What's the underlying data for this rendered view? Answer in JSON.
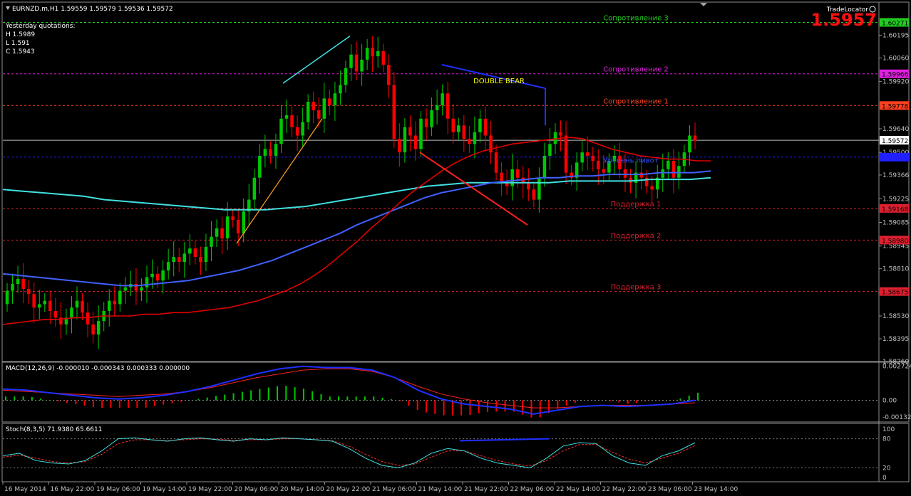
{
  "header": {
    "symbol_line": "EURNZD.m,H1  1.59559 1.59579 1.59536 1.59572",
    "yesterday_title": "Yesterday quotations:",
    "yesterday_h": "H 1.5989",
    "yesterday_l": "L 1.591",
    "yesterday_c": "C 1.5943",
    "brand": "TradeLocator",
    "big_price": "1.5957",
    "pattern_label": "DOUBLE BEAR",
    "pivot_label": "Уровень пивот"
  },
  "colors": {
    "bull": "#00c800",
    "bear": "#ff0000",
    "ma_fast": "#e00000",
    "ma_mid": "#4060ff",
    "ma_slow": "#40e0e0",
    "grid_text": "#c0c0c0",
    "resistance3": "#22cc22",
    "resistance2": "#e020e0",
    "resistance1": "#ff4020",
    "support": "#e02030"
  },
  "levels": [
    {
      "name": "Сопротивление 3",
      "price": 1.60271,
      "badge": "1.60271",
      "color": "#22cc22",
      "badge_bg": "#22cc22",
      "badge_fg": "#000000"
    },
    {
      "name": "Сопротивление 2",
      "price": 1.59966,
      "badge": "1.59966",
      "color": "#e020e0",
      "badge_bg": "#e020e0",
      "badge_fg": "#000000"
    },
    {
      "name": "Сопротивление 1",
      "price": 1.59778,
      "badge": "1.59778",
      "color": "#ff4020",
      "badge_bg": "#ff4020",
      "badge_fg": "#000000"
    },
    {
      "name": "",
      "price": 1.59572,
      "badge": "1.59572",
      "color": "#c0c0c0",
      "badge_bg": "#ffffff",
      "badge_fg": "#000000"
    },
    {
      "name": "",
      "price": 1.59472,
      "badge": "1.59472",
      "color": "#2020ff",
      "badge_bg": "#2020ff",
      "badge_fg": "#2020ff"
    },
    {
      "name": "Поддержка 1",
      "price": 1.59168,
      "badge": "1.59168",
      "color": "#e02030",
      "badge_bg": "#e02030",
      "badge_fg": "#000000"
    },
    {
      "name": "Поддержка 2",
      "price": 1.5898,
      "badge": "1.58980",
      "color": "#e02030",
      "badge_bg": "#e02030",
      "badge_fg": "#000000"
    },
    {
      "name": "Поддержка 3",
      "price": 1.58675,
      "badge": "1.58675",
      "color": "#e02030",
      "badge_bg": "#e02030",
      "badge_fg": "#000000"
    }
  ],
  "chart_data": [
    {
      "type": "candlestick",
      "title": "EURNZD.m,H1",
      "ylim": [
        1.5826,
        1.6037
      ],
      "y_ticks": [
        "1.60195",
        "1.60060",
        "1.59920",
        "1.59640",
        "1.59500",
        "1.59366",
        "1.59225",
        "1.59085",
        "1.58945",
        "1.58810",
        "1.58670",
        "1.58530",
        "1.58395",
        "1.58260"
      ],
      "x_ticks": [
        "16 May 2014",
        "16 May 22:00",
        "19 May 06:00",
        "19 May 14:00",
        "19 May 22:00",
        "20 May 06:00",
        "20 May 14:00",
        "20 May 22:00",
        "21 May 06:00",
        "21 May 14:00",
        "21 May 22:00",
        "22 May 06:00",
        "22 May 14:00",
        "22 May 22:00",
        "23 May 06:00",
        "23 May 14:00"
      ],
      "candles_close": [
        1.5868,
        1.5872,
        1.5875,
        1.5869,
        1.5866,
        1.5858,
        1.586,
        1.5862,
        1.5856,
        1.5852,
        1.5848,
        1.5852,
        1.5858,
        1.5862,
        1.5855,
        1.5848,
        1.5842,
        1.585,
        1.5856,
        1.5862,
        1.586,
        1.5868,
        1.587,
        1.5872,
        1.5868,
        1.587,
        1.5876,
        1.5878,
        1.5874,
        1.588,
        1.5885,
        1.5888,
        1.5885,
        1.589,
        1.5893,
        1.5888,
        1.5885,
        1.5894,
        1.59,
        1.5905,
        1.5899,
        1.5912,
        1.591,
        1.5902,
        1.5915,
        1.5922,
        1.5935,
        1.5948,
        1.5952,
        1.5948,
        1.5955,
        1.597,
        1.5972,
        1.5965,
        1.596,
        1.5968,
        1.598,
        1.5975,
        1.597,
        1.5982,
        1.5978,
        1.5985,
        1.599,
        1.6,
        1.6008,
        1.5998,
        1.6005,
        1.6012,
        1.6007,
        1.601,
        1.6002,
        1.599,
        1.5958,
        1.595,
        1.5965,
        1.596,
        1.5952,
        1.597,
        1.5965,
        1.5975,
        1.5978,
        1.5985,
        1.597,
        1.5962,
        1.5966,
        1.5958,
        1.5955,
        1.5962,
        1.597,
        1.596,
        1.595,
        1.5938,
        1.5932,
        1.593,
        1.594,
        1.5935,
        1.5932,
        1.5928,
        1.5922,
        1.5935,
        1.5948,
        1.5955,
        1.5962,
        1.596,
        1.5938,
        1.5935,
        1.5944,
        1.595,
        1.5948,
        1.5945,
        1.594,
        1.5938,
        1.5945,
        1.5948,
        1.594,
        1.5935,
        1.5932,
        1.5938,
        1.5935,
        1.593,
        1.5928,
        1.5935,
        1.594,
        1.5945,
        1.5935,
        1.5942,
        1.595,
        1.596,
        1.5957
      ],
      "candles_open": [
        1.586,
        1.5868,
        1.5872,
        1.5875,
        1.5869,
        1.5866,
        1.5858,
        1.586,
        1.5862,
        1.5856,
        1.5852,
        1.5848,
        1.5852,
        1.5858,
        1.5862,
        1.5855,
        1.5848,
        1.5842,
        1.585,
        1.5856,
        1.5862,
        1.586,
        1.5868,
        1.587,
        1.5872,
        1.5868,
        1.587,
        1.5876,
        1.5878,
        1.5874,
        1.588,
        1.5885,
        1.5888,
        1.5885,
        1.589,
        1.5893,
        1.5888,
        1.5885,
        1.5894,
        1.59,
        1.5905,
        1.5899,
        1.5912,
        1.591,
        1.5902,
        1.5915,
        1.5922,
        1.5935,
        1.5948,
        1.5952,
        1.5948,
        1.5955,
        1.597,
        1.5972,
        1.5965,
        1.596,
        1.5968,
        1.598,
        1.5975,
        1.597,
        1.5982,
        1.5978,
        1.5985,
        1.599,
        1.6,
        1.6008,
        1.5998,
        1.6005,
        1.6012,
        1.6007,
        1.601,
        1.6002,
        1.599,
        1.5958,
        1.595,
        1.5965,
        1.596,
        1.5952,
        1.597,
        1.5965,
        1.5975,
        1.5978,
        1.5985,
        1.597,
        1.5962,
        1.5966,
        1.5958,
        1.5955,
        1.5962,
        1.597,
        1.596,
        1.595,
        1.5938,
        1.5932,
        1.593,
        1.594,
        1.5935,
        1.5932,
        1.5928,
        1.5922,
        1.5935,
        1.5948,
        1.5955,
        1.5962,
        1.596,
        1.5938,
        1.5935,
        1.5944,
        1.595,
        1.5948,
        1.5945,
        1.594,
        1.5938,
        1.5945,
        1.5948,
        1.594,
        1.5935,
        1.5932,
        1.5938,
        1.5935,
        1.593,
        1.5928,
        1.5935,
        1.594,
        1.5945,
        1.5935,
        1.5942,
        1.595,
        1.596
      ],
      "ma_fast": [
        1.5848,
        1.5849,
        1.585,
        1.5851,
        1.5851,
        1.5852,
        1.5852,
        1.5853,
        1.5853,
        1.5853,
        1.5854,
        1.5854,
        1.5855,
        1.5855,
        1.5856,
        1.5857,
        1.5858,
        1.586,
        1.5862,
        1.5865,
        1.5868,
        1.5872,
        1.5877,
        1.5883,
        1.589,
        1.5897,
        1.5905,
        1.5912,
        1.592,
        1.5927,
        1.5933,
        1.5939,
        1.5944,
        1.5948,
        1.5951,
        1.5953,
        1.5955,
        1.5956,
        1.5957,
        1.5958,
        1.5959,
        1.5958,
        1.5955,
        1.5952,
        1.595,
        1.5948,
        1.5947,
        1.5946,
        1.5946,
        1.5945,
        1.5945
      ],
      "ma_mid": [
        1.5878,
        1.5877,
        1.5876,
        1.5875,
        1.5874,
        1.5873,
        1.5872,
        1.5871,
        1.5871,
        1.5872,
        1.5873,
        1.5874,
        1.5876,
        1.5878,
        1.588,
        1.5883,
        1.5886,
        1.589,
        1.5894,
        1.5898,
        1.5902,
        1.5907,
        1.5911,
        1.5915,
        1.5919,
        1.5923,
        1.5926,
        1.5928,
        1.593,
        1.5932,
        1.5933,
        1.5934,
        1.5935,
        1.5935,
        1.5936,
        1.5936,
        1.5937,
        1.5937,
        1.5937,
        1.5938,
        1.5938,
        1.5938,
        1.5939
      ],
      "ma_slow": [
        1.5928,
        1.5927,
        1.5926,
        1.5925,
        1.5924,
        1.5922,
        1.5921,
        1.592,
        1.5919,
        1.5918,
        1.5917,
        1.5916,
        1.5916,
        1.5916,
        1.5917,
        1.5918,
        1.592,
        1.5922,
        1.5924,
        1.5926,
        1.5928,
        1.593,
        1.5931,
        1.5932,
        1.5932,
        1.5932,
        1.5932,
        1.5932,
        1.5933,
        1.5933,
        1.5933,
        1.5933,
        1.5934,
        1.5934,
        1.5934,
        1.5935
      ]
    },
    {
      "type": "bar",
      "title": "MACD(12,26,9) -0.000010 -0.000343 0.000333 0.000000",
      "ylim": [
        -0.0015,
        0.0028
      ],
      "y_ticks": [
        "0.002724",
        "0.00",
        "-0.001325"
      ],
      "macd_line": [
        0.0009,
        0.0008,
        0.0006,
        0.0004,
        0.0002,
        0.0001,
        0.0002,
        0.0004,
        0.0007,
        0.0011,
        0.0016,
        0.0021,
        0.0025,
        0.0027,
        0.0026,
        0.0026,
        0.0024,
        0.0018,
        0.0008,
        0.0001,
        -0.0003,
        -0.0005,
        -0.0007,
        -0.0011,
        -0.0008,
        -0.0005,
        -0.0004,
        -0.0005,
        -0.0004,
        -0.0003,
        0.0
      ],
      "signal_line": [
        0.0008,
        0.0007,
        0.0006,
        0.0005,
        0.0004,
        0.0003,
        0.0004,
        0.0005,
        0.0007,
        0.001,
        0.0014,
        0.0018,
        0.0021,
        0.0024,
        0.0025,
        0.0025,
        0.0023,
        0.0018,
        0.0011,
        0.0005,
        0.0001,
        -0.0002,
        -0.0004,
        -0.0006,
        -0.0006,
        -0.0005,
        -0.0004,
        -0.0004,
        -0.0004,
        -0.0003,
        -0.0002
      ]
    },
    {
      "type": "line",
      "title": "Stoch(8,3,5) 71.9380 65.6611",
      "ylim": [
        0,
        100
      ],
      "y_ticks": [
        "100",
        "80",
        "20",
        "0"
      ],
      "k_line": [
        45,
        50,
        35,
        30,
        28,
        35,
        55,
        80,
        82,
        78,
        75,
        80,
        82,
        78,
        75,
        80,
        78,
        82,
        80,
        78,
        75,
        60,
        40,
        25,
        20,
        30,
        50,
        60,
        55,
        40,
        30,
        25,
        20,
        40,
        65,
        72,
        70,
        45,
        30,
        25,
        45,
        55,
        72
      ],
      "d_line": [
        42,
        46,
        40,
        33,
        30,
        33,
        48,
        70,
        78,
        78,
        76,
        78,
        80,
        79,
        77,
        78,
        78,
        80,
        80,
        78,
        76,
        65,
        48,
        33,
        25,
        28,
        42,
        55,
        55,
        45,
        35,
        28,
        24,
        35,
        55,
        68,
        68,
        52,
        38,
        30,
        40,
        50,
        66
      ]
    }
  ]
}
